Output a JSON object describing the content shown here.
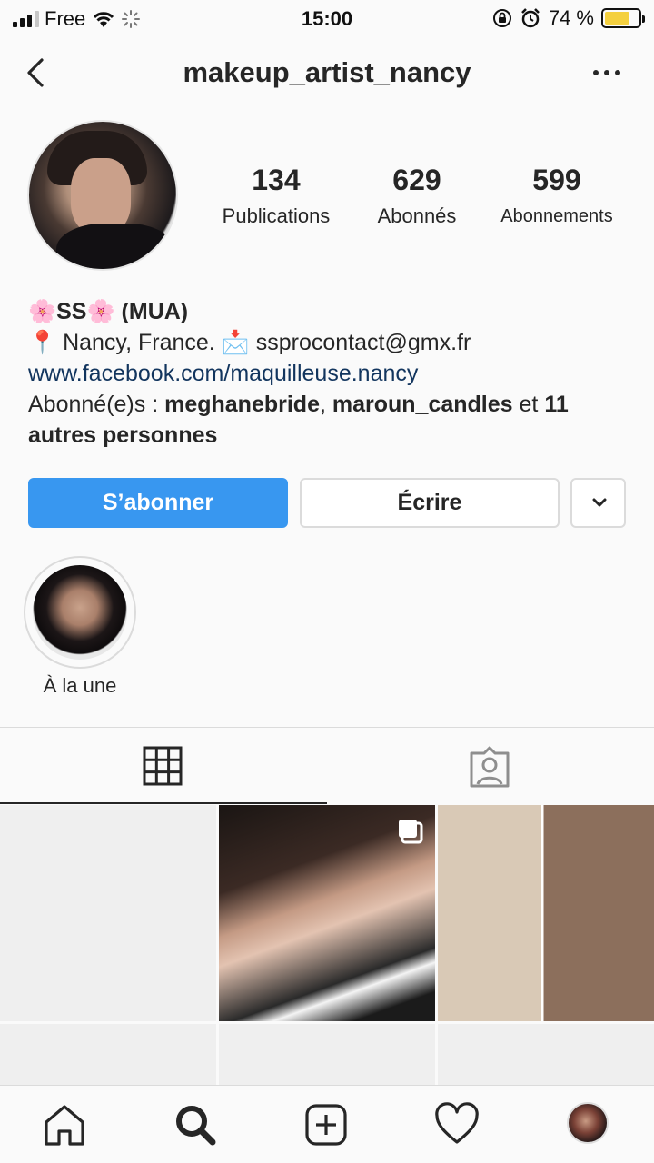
{
  "status_bar": {
    "carrier": "Free",
    "time": "15:00",
    "battery": "74 %",
    "battery_level": 0.74
  },
  "header": {
    "username": "makeup_artist_nancy"
  },
  "stats": [
    {
      "value": "134",
      "label": "Publications"
    },
    {
      "value": "629",
      "label": "Abonnés"
    },
    {
      "value": "599",
      "label": "Abonnements"
    }
  ],
  "bio": {
    "name": "🌸SS🌸 (MUA)",
    "location_line": "📍 Nancy, France. 📩 ssprocontact@gmx.fr",
    "link": "www.facebook.com/maquilleuse.nancy",
    "followed_prefix": "Abonné(e)s : ",
    "followed_user1": "meghanebride",
    "followed_sep": ", ",
    "followed_user2": "maroun_candles",
    "followed_and": " et ",
    "followed_rest": "11 autres personnes"
  },
  "actions": {
    "follow_label": "S’abonner",
    "message_label": "Écrire"
  },
  "highlights": [
    {
      "label": "À la une"
    }
  ],
  "tabs": [
    {
      "icon": "grid-icon"
    },
    {
      "icon": "tagged-icon"
    }
  ],
  "bottom_nav": [
    {
      "icon": "home-icon"
    },
    {
      "icon": "search-icon"
    },
    {
      "icon": "new-post-icon"
    },
    {
      "icon": "heart-icon"
    },
    {
      "icon": "profile-avatar"
    }
  ],
  "colors": {
    "accent": "#3897f0",
    "link": "#12355e",
    "text": "#262626",
    "border": "#dbdbdb"
  }
}
